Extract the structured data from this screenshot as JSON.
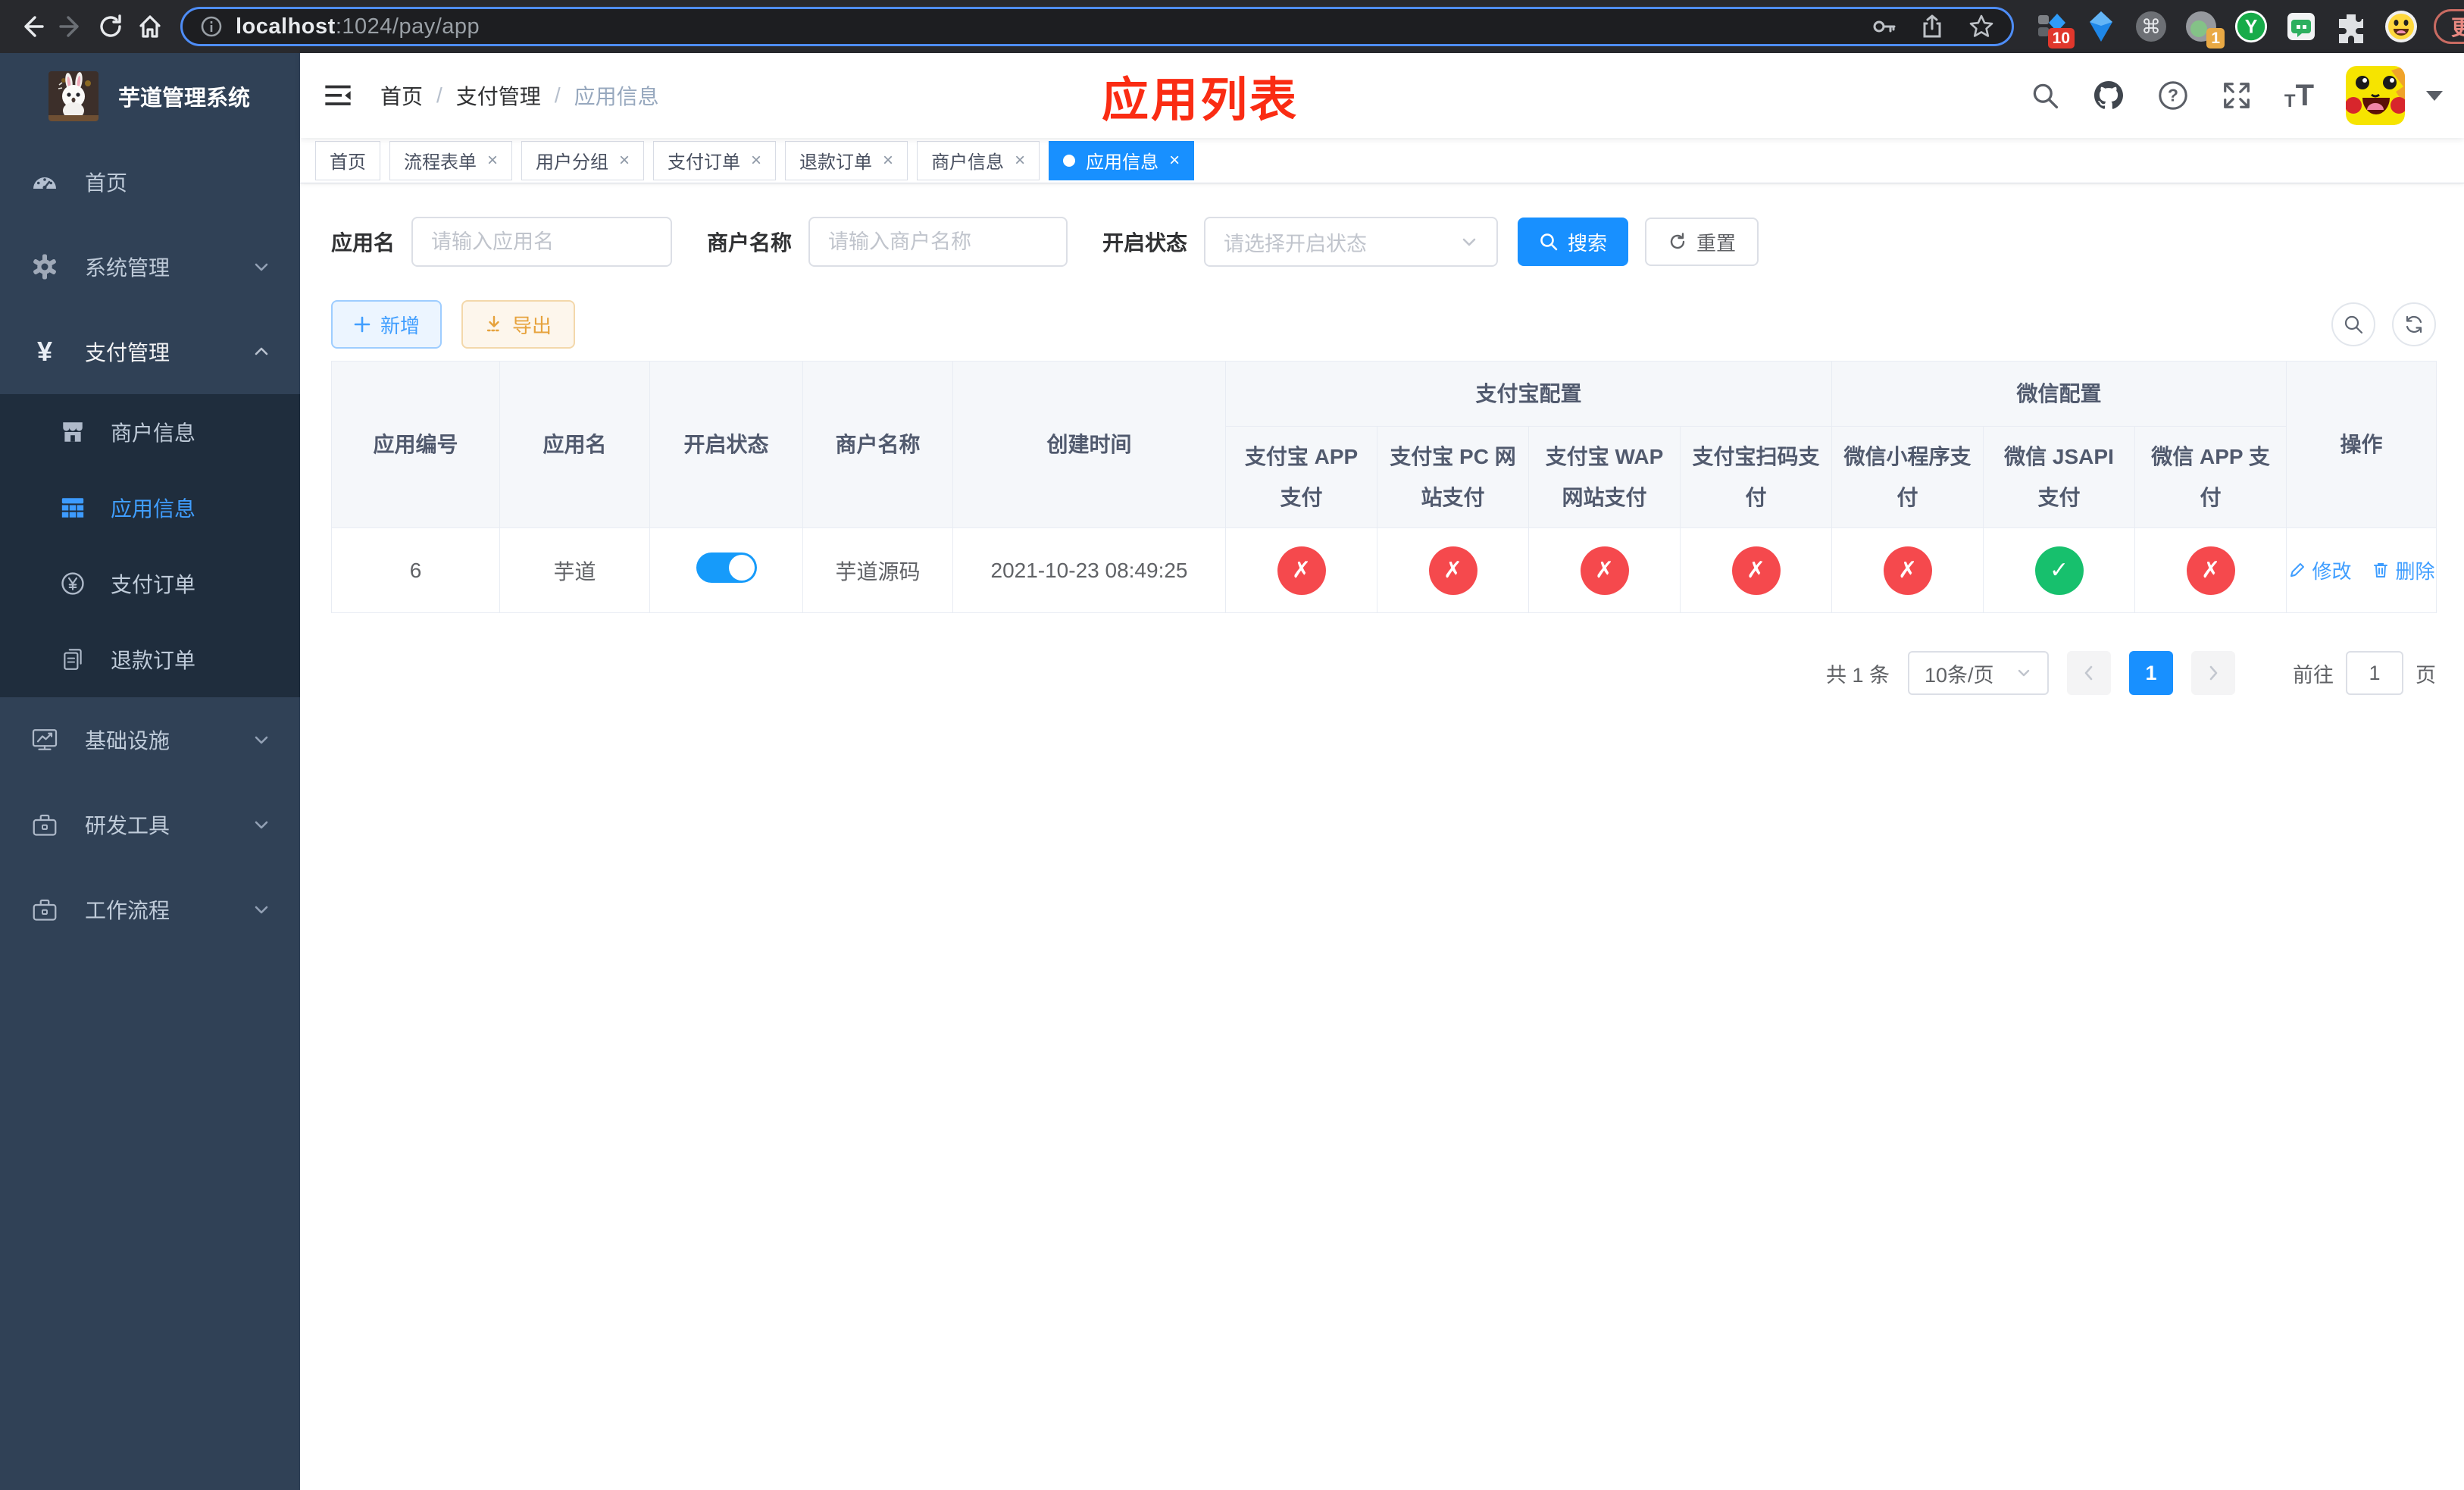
{
  "browser": {
    "url_host": "localhost",
    "url_rest": ":1024/pay/app",
    "ext_badge_count": "10",
    "ext_badge_one": "1",
    "ext_y_label": "Y",
    "cmd_glyph": "⌘",
    "update_button": "更新"
  },
  "sidebar": {
    "logo_title": "芋道管理系统",
    "items": {
      "home": "首页",
      "system": "系统管理",
      "payment": "支付管理",
      "infra": "基础设施",
      "devtools": "研发工具",
      "workflow": "工作流程"
    },
    "payment_children": {
      "merchant": "商户信息",
      "app": "应用信息",
      "order": "支付订单",
      "refund": "退款订单"
    },
    "yen_glyph": "¥"
  },
  "navbar": {
    "breadcrumb": [
      "首页",
      "支付管理",
      "应用信息"
    ],
    "separator": "/",
    "overlay_title": "应用列表",
    "question_glyph": "?"
  },
  "tabs": [
    {
      "label": "首页",
      "closable": false
    },
    {
      "label": "流程表单",
      "closable": true
    },
    {
      "label": "用户分组",
      "closable": true
    },
    {
      "label": "支付订单",
      "closable": true
    },
    {
      "label": "退款订单",
      "closable": true
    },
    {
      "label": "商户信息",
      "closable": true
    },
    {
      "label": "应用信息",
      "closable": true,
      "active": true
    }
  ],
  "filters": {
    "app_name_label": "应用名",
    "app_name_placeholder": "请输入应用名",
    "merchant_label": "商户名称",
    "merchant_placeholder": "请输入商户名称",
    "status_label": "开启状态",
    "status_placeholder": "请选择开启状态",
    "search_button": "搜索",
    "reset_button": "重置"
  },
  "toolbar": {
    "add_button": "新增",
    "export_button": "导出"
  },
  "table": {
    "headers": {
      "app_id": "应用编号",
      "app_name": "应用名",
      "status": "开启状态",
      "merchant": "商户名称",
      "created": "创建时间",
      "alipay_group": "支付宝配置",
      "wechat_group": "微信配置",
      "actions": "操作",
      "alipay_app": "支付宝 APP 支付",
      "alipay_pc": "支付宝 PC 网站支付",
      "alipay_wap": "支付宝 WAP 网站支付",
      "alipay_qr": "支付宝扫码支付",
      "wechat_mini": "微信小程序支付",
      "wechat_jsapi": "微信 JSAPI 支付",
      "wechat_app": "微信 APP 支付"
    },
    "row": {
      "app_id": "6",
      "app_name": "芋道",
      "enabled": true,
      "merchant": "芋道源码",
      "created": "2021-10-23 08:49:25",
      "statuses": [
        "off",
        "off",
        "off",
        "off",
        "off",
        "on",
        "off"
      ],
      "edit_link": "修改",
      "delete_link": "删除"
    }
  },
  "icons": {
    "close": "×",
    "cross": "✗",
    "check": "✓",
    "t_small": "T",
    "t_large": "T"
  },
  "pagination": {
    "total": "共 1 条",
    "page_size": "10条/页",
    "current_page": "1",
    "goto_label": "前往",
    "goto_value": "1",
    "goto_unit": "页"
  }
}
